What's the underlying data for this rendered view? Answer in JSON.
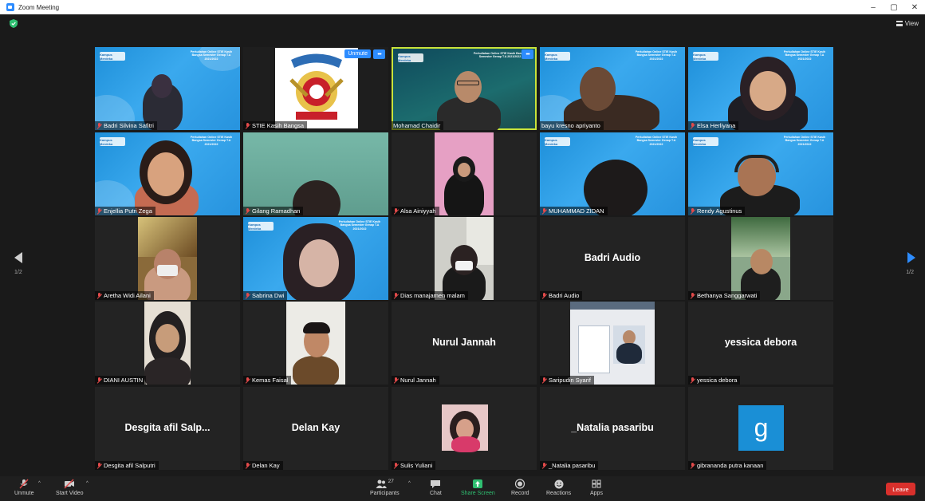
{
  "window": {
    "title": "Zoom Meeting",
    "minimize": "–",
    "maximize": "▢",
    "close": "✕"
  },
  "view_button": {
    "label": "View"
  },
  "pagination": {
    "left": "1/2",
    "right": "1/2"
  },
  "banner": {
    "logo": "Kampus Merdeka",
    "text": "Perkuliahan Online STIE Kasih Bangsa Semester Genap T.A 2021/2022"
  },
  "tile_controls": {
    "unmute": "Unmute",
    "more": "•••"
  },
  "participants": [
    {
      "name": "Badri Silvina Safitri",
      "big": ""
    },
    {
      "name": "STIE Kasih Bangsa",
      "big": ""
    },
    {
      "name": "Mohamad Chaidir",
      "big": ""
    },
    {
      "name": "bayu kresno apriyanto",
      "big": ""
    },
    {
      "name": "Elsa Herliyana",
      "big": ""
    },
    {
      "name": "Enjellia Putri Zega",
      "big": ""
    },
    {
      "name": "Gilang Ramadhan",
      "big": ""
    },
    {
      "name": "Alsa Ainiyyah",
      "big": ""
    },
    {
      "name": "MUHAMMAD ZIDAN",
      "big": ""
    },
    {
      "name": "Rendy Agustinus",
      "big": ""
    },
    {
      "name": "Aretha Widi Ailani",
      "big": ""
    },
    {
      "name": "Sabrina Dwi",
      "big": ""
    },
    {
      "name": "Dias manajamen malam",
      "big": ""
    },
    {
      "name": "Badri Audio",
      "big": "Badri Audio"
    },
    {
      "name": "Bethanya Sanggarwati",
      "big": ""
    },
    {
      "name": "DIANI AUSTIN",
      "big": ""
    },
    {
      "name": "Kemas Faisal",
      "big": ""
    },
    {
      "name": "Nurul Jannah",
      "big": "Nurul Jannah"
    },
    {
      "name": "Saripudin Syarif",
      "big": ""
    },
    {
      "name": "yessica debora",
      "big": "yessica debora"
    },
    {
      "name": "Desgita afil Salputri",
      "big": "Desgita afil Salp..."
    },
    {
      "name": "Delan Kay",
      "big": "Delan Kay"
    },
    {
      "name": "Sulis Yuliani",
      "big": ""
    },
    {
      "name": "_Natalia pasaribu",
      "big": "_Natalia pasaribu"
    },
    {
      "name": "gibrananda putra kanaan",
      "big": "",
      "avatar_letter": "g"
    }
  ],
  "toolbar": {
    "unmute": "Unmute",
    "start_video": "Start Video",
    "participants": "Participants",
    "participants_count": "27",
    "chat": "Chat",
    "share_screen": "Share Screen",
    "record": "Record",
    "reactions": "Reactions",
    "apps": "Apps",
    "leave": "Leave"
  },
  "colors": {
    "accent": "#2d8cff",
    "active_speaker": "#c9e33a",
    "leave": "#d9302c",
    "share": "#2fbf71",
    "muted": "#e34a4a"
  }
}
